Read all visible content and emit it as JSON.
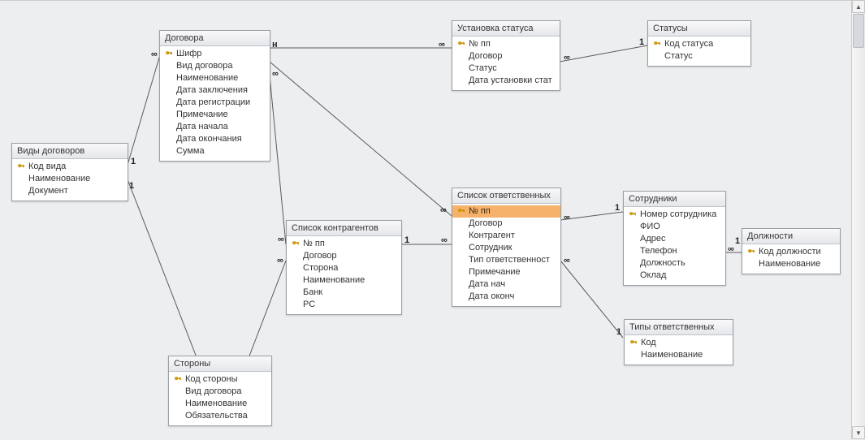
{
  "tables": {
    "vidy_dogovorov": {
      "title": "Виды договоров",
      "fields": [
        {
          "name": "Код вида",
          "key": true
        },
        {
          "name": "Наименование",
          "key": false
        },
        {
          "name": "Документ",
          "key": false
        }
      ]
    },
    "dogovora": {
      "title": "Договора",
      "fields": [
        {
          "name": "Шифр",
          "key": true
        },
        {
          "name": "Вид договора",
          "key": false
        },
        {
          "name": "Наименование",
          "key": false
        },
        {
          "name": "Дата заключения",
          "key": false
        },
        {
          "name": "Дата регистрации",
          "key": false
        },
        {
          "name": "Примечание",
          "key": false
        },
        {
          "name": "Дата начала",
          "key": false
        },
        {
          "name": "Дата окончания",
          "key": false
        },
        {
          "name": "Сумма",
          "key": false
        }
      ]
    },
    "ustanovka_statusa": {
      "title": "Установка статуса",
      "fields": [
        {
          "name": "№ пп",
          "key": true
        },
        {
          "name": "Договор",
          "key": false
        },
        {
          "name": "Статус",
          "key": false
        },
        {
          "name": "Дата установки стат",
          "key": false
        }
      ]
    },
    "statusy": {
      "title": "Статусы",
      "fields": [
        {
          "name": "Код статуса",
          "key": true
        },
        {
          "name": "Статус",
          "key": false
        }
      ]
    },
    "spisok_kontragentov": {
      "title": "Список контрагентов",
      "fields": [
        {
          "name": "№ пп",
          "key": true
        },
        {
          "name": "Договор",
          "key": false
        },
        {
          "name": "Сторона",
          "key": false
        },
        {
          "name": "Наименование",
          "key": false
        },
        {
          "name": "Банк",
          "key": false
        },
        {
          "name": "РС",
          "key": false
        }
      ]
    },
    "spisok_otvetstvennyh": {
      "title": "Список ответственных",
      "fields": [
        {
          "name": "№ пп",
          "key": true,
          "selected": true
        },
        {
          "name": "Договор",
          "key": false
        },
        {
          "name": "Контрагент",
          "key": false
        },
        {
          "name": "Сотрудник",
          "key": false
        },
        {
          "name": "Тип ответственност",
          "key": false
        },
        {
          "name": "Примечание",
          "key": false
        },
        {
          "name": "Дата нач",
          "key": false
        },
        {
          "name": "Дата оконч",
          "key": false
        }
      ]
    },
    "sotrudniki": {
      "title": "Сотрудники",
      "fields": [
        {
          "name": "Номер сотрудника",
          "key": true
        },
        {
          "name": "ФИО",
          "key": false
        },
        {
          "name": "Адрес",
          "key": false
        },
        {
          "name": "Телефон",
          "key": false
        },
        {
          "name": "Должность",
          "key": false
        },
        {
          "name": "Оклад",
          "key": false
        }
      ]
    },
    "dolzhnosti": {
      "title": "Должности",
      "fields": [
        {
          "name": "Код должности",
          "key": true
        },
        {
          "name": "Наименование",
          "key": false
        }
      ]
    },
    "tipy_otvetstvennyh": {
      "title": "Типы ответственных",
      "fields": [
        {
          "name": "Код",
          "key": true
        },
        {
          "name": "Наименование",
          "key": false
        }
      ]
    },
    "storony": {
      "title": "Стороны",
      "fields": [
        {
          "name": "Код стороны",
          "key": true
        },
        {
          "name": "Вид договора",
          "key": false
        },
        {
          "name": "Наименование",
          "key": false
        },
        {
          "name": "Обязательства",
          "key": false
        }
      ]
    }
  },
  "labels": {
    "one": "1",
    "many_n": "н",
    "inf": "∞"
  }
}
